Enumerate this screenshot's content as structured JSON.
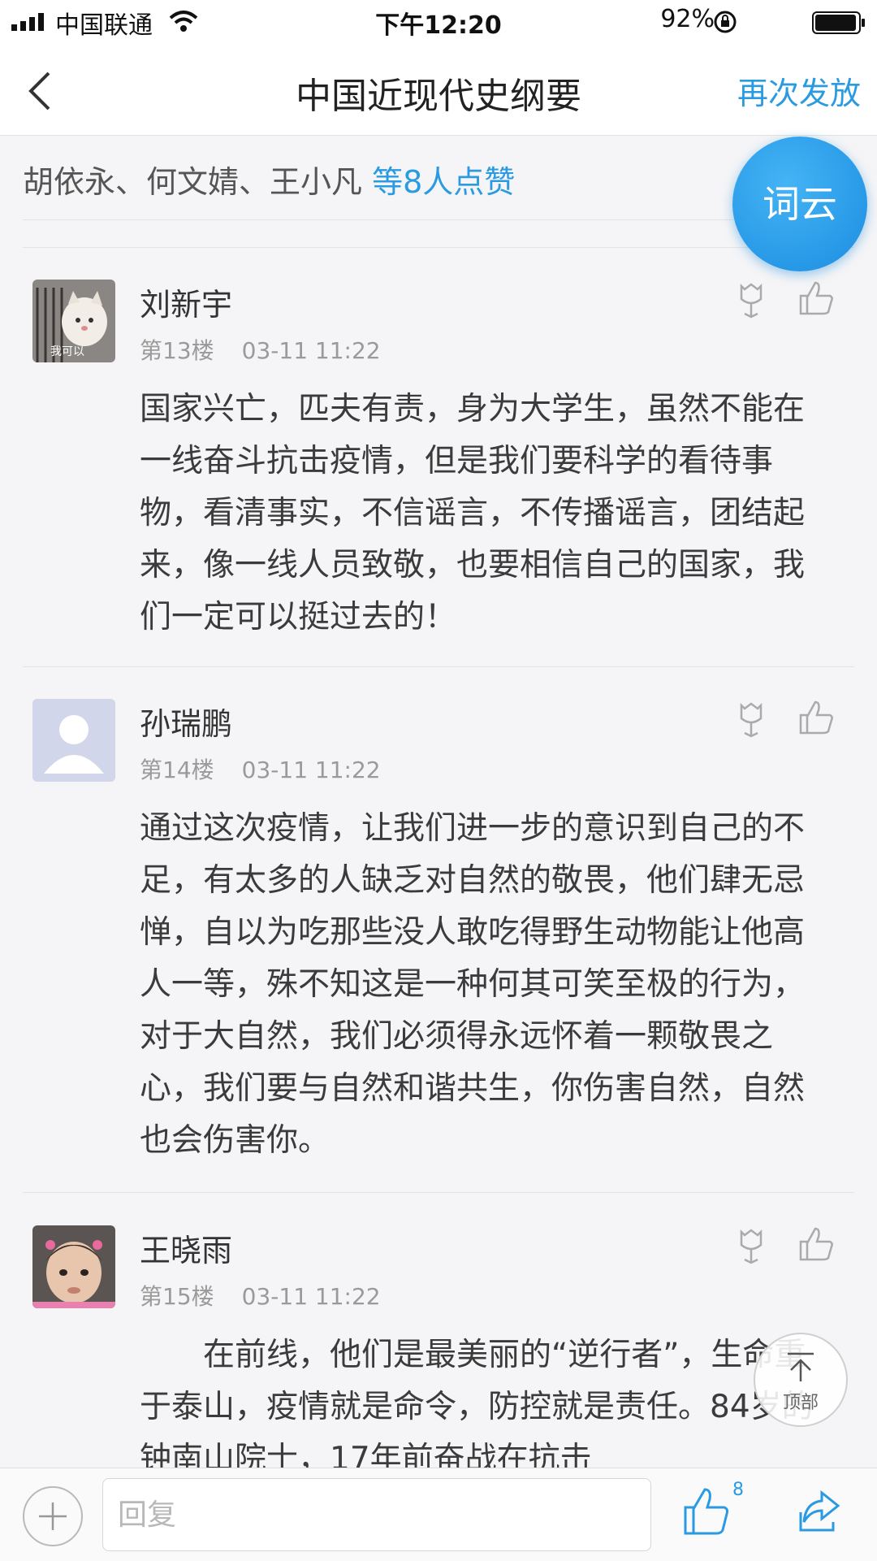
{
  "status": {
    "carrier": "中国联通",
    "time": "下午12:20",
    "battery": "92%"
  },
  "nav": {
    "title": "中国近现代史纲要",
    "action": "再次发放"
  },
  "likes": {
    "names": "胡依永、何文婧、王小凡",
    "more": "等8人点赞"
  },
  "cloud_button": "词云",
  "comments": [
    {
      "name": "刘新宇",
      "floor": "第13楼",
      "time": "03-11 11:22",
      "avatar_caption": "我可以",
      "text": "国家兴亡，匹夫有责，身为大学生，虽然不能在一线奋斗抗击疫情，但是我们要科学的看待事物，看清事实，不信谣言，不传播谣言，团结起来，像一线人员致敬，也要相信自己的国家，我们一定可以挺过去的！"
    },
    {
      "name": "孙瑞鹏",
      "floor": "第14楼",
      "time": "03-11 11:22",
      "text": "通过这次疫情，让我们进一步的意识到自己的不足，有太多的人缺乏对自然的敬畏，他们肆无忌惮，自以为吃那些没人敢吃得野生动物能让他高人一等，殊不知这是一种何其可笑至极的行为，对于大自然，我们必须得永远怀着一颗敬畏之心，我们要与自然和谐共生，你伤害自然，自然也会伤害你。"
    },
    {
      "name": "王晓雨",
      "floor": "第15楼",
      "time": "03-11 11:22",
      "text": "　　在前线，他们是最美丽的“逆行者”，生命重于泰山，疫情就是命令，防控就是责任。84岁的钟南山院士，17年前奋战在抗击"
    }
  ],
  "to_top": "顶部",
  "bottom": {
    "reply_placeholder": "回复",
    "like_count": "8"
  },
  "colors": {
    "accent": "#2a9be0",
    "background": "#f5f5f7"
  },
  "icons": [
    "signal-icon",
    "wifi-icon",
    "orientation-lock-icon",
    "battery-icon",
    "back-chevron-icon",
    "flower-icon",
    "thumb-up-icon",
    "arrow-up-icon",
    "plus-icon",
    "share-icon"
  ]
}
